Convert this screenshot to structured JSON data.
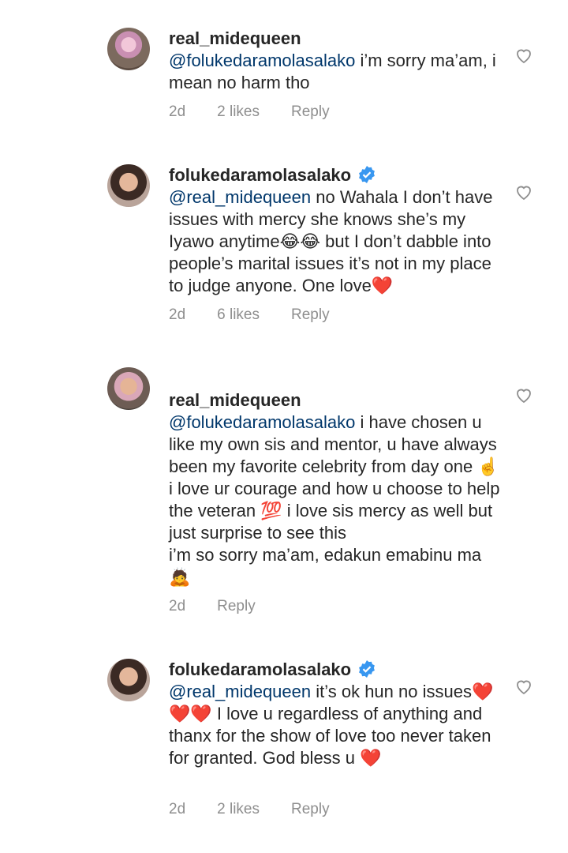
{
  "comments": [
    {
      "username": "real_midequeen",
      "verified": false,
      "mention": "@folukedaramolasalako",
      "text": " i’m sorry ma’am, i mean no harm tho",
      "time": "2d",
      "likes": "2 likes",
      "reply_label": "Reply"
    },
    {
      "username": "folukedaramolasalako",
      "verified": true,
      "mention": "@real_midequeen",
      "text": " no Wahala I don’t have issues with mercy she knows she’s my Iyawo anytime😂😂 but I don’t dabble into people’s marital issues it’s not in my place to judge anyone. One love❤️",
      "time": "2d",
      "likes": "6 likes",
      "reply_label": "Reply"
    },
    {
      "username": "real_midequeen",
      "verified": false,
      "mention": "@folukedaramolasalako",
      "text": " i have chosen u like my own sis and mentor, u have always been my favorite celebrity from day one ☝️ i love ur courage and how u choose to help the veteran 💯 i love sis mercy as well but just surprise to see this\ni’m so sorry ma’am, edakun emabinu ma 🙇",
      "time": "2d",
      "likes": "",
      "reply_label": "Reply"
    },
    {
      "username": "folukedaramolasalako",
      "verified": true,
      "mention": "@real_midequeen",
      "text": " it’s ok hun no issues❤️❤️❤️ I love u regardless of anything and thanx for the show of love too never taken for granted. God bless u ❤️",
      "time": "2d",
      "likes": "2 likes",
      "reply_label": "Reply"
    }
  ],
  "colors": {
    "mention": "#00376b",
    "meta": "#8e8e8e",
    "verified": "#3897f0"
  },
  "icons": {
    "like": "heart-outline-icon",
    "verified": "verified-badge-icon"
  }
}
